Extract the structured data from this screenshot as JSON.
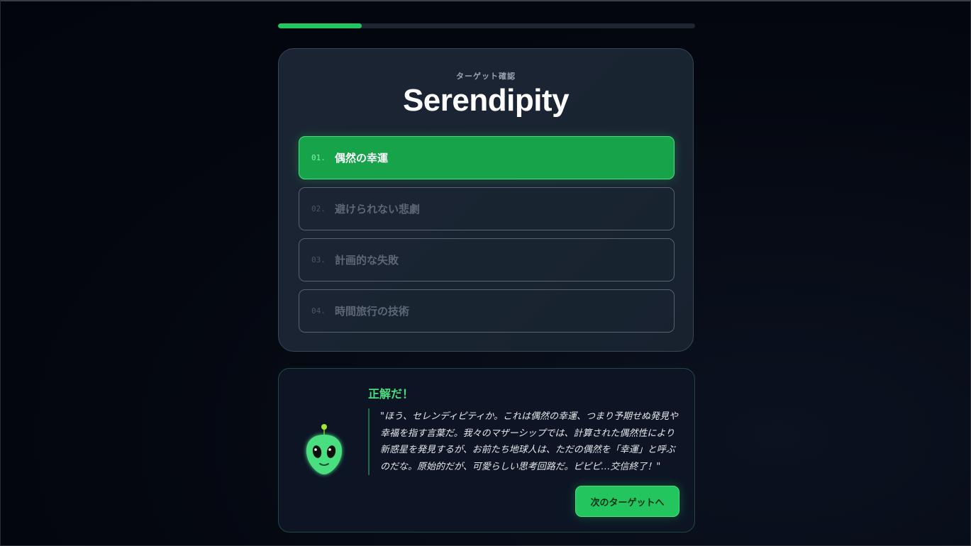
{
  "progress": {
    "percent": 20
  },
  "quiz": {
    "eyebrow": "ターゲット確認",
    "word": "Serendipity",
    "options": [
      {
        "number": "01.",
        "label": "偶然の幸運",
        "state": "correct"
      },
      {
        "number": "02.",
        "label": "避けられない悲劇",
        "state": "disabled"
      },
      {
        "number": "03.",
        "label": "計画的な失敗",
        "state": "disabled"
      },
      {
        "number": "04.",
        "label": "時間旅行の技術",
        "state": "disabled"
      }
    ]
  },
  "feedback": {
    "verdict": "正解だ！",
    "quote": "\"ほう、セレンディピティか。これは偶然の幸運、つまり予期せぬ発見や幸福を指す言葉だ。我々のマザーシップでは、計算された偶然性により新惑星を発見するが、お前たち地球人は、ただの偶然を「幸運」と呼ぶのだな。原始的だが、可愛らしい思考回路だ。ピピピ…交信終了！\"",
    "avatar_icon": "alien-icon",
    "next_label": "次のターゲットへ"
  },
  "colors": {
    "accent": "#22c55e",
    "correct_bg": "#16a34a",
    "card_bg": "#1b2433",
    "page_bg": "#04070f"
  }
}
